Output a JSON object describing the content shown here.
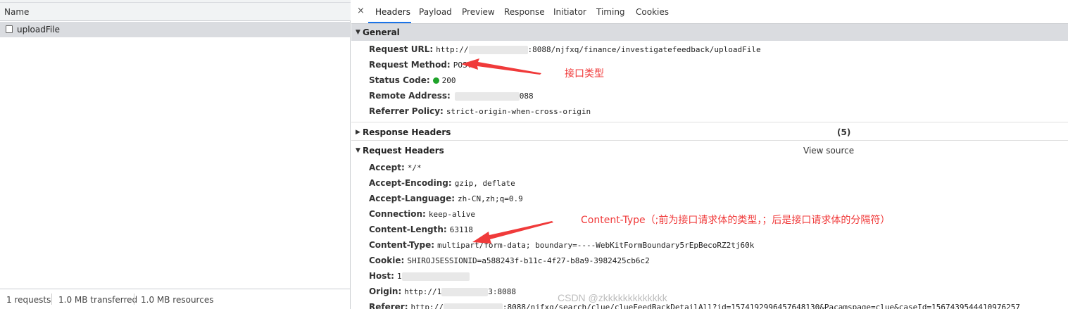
{
  "requests": {
    "column_header": "Name",
    "items": [
      {
        "name": "uploadFile"
      }
    ],
    "footer": {
      "requests": "1 requests",
      "transferred": "1.0 MB transferred",
      "resources": "1.0 MB resources"
    }
  },
  "tabs": {
    "close_glyph": "×",
    "items": [
      "Headers",
      "Payload",
      "Preview",
      "Response",
      "Initiator",
      "Timing",
      "Cookies"
    ],
    "active": "Headers"
  },
  "general": {
    "title": "General",
    "request_url": {
      "label": "Request URL:",
      "prefix": "http://",
      "suffix": ":8088/njfxq/finance/investigatefeedback/uploadFile"
    },
    "request_method": {
      "label": "Request Method:",
      "value": "POST"
    },
    "status_code": {
      "label": "Status Code:",
      "value": "200"
    },
    "remote_address": {
      "label": "Remote Address:",
      "suffix": "088"
    },
    "referrer_policy": {
      "label": "Referrer Policy:",
      "value": "strict-origin-when-cross-origin"
    }
  },
  "response_headers": {
    "title": "Response Headers",
    "count": "(5)"
  },
  "request_headers": {
    "title": "Request Headers",
    "view_source": "View source",
    "accept": {
      "label": "Accept:",
      "value": "*/*"
    },
    "accept_encoding": {
      "label": "Accept-Encoding:",
      "value": "gzip, deflate"
    },
    "accept_language": {
      "label": "Accept-Language:",
      "value": "zh-CN,zh;q=0.9"
    },
    "connection": {
      "label": "Connection:",
      "value": "keep-alive"
    },
    "content_length": {
      "label": "Content-Length:",
      "value": "63118"
    },
    "content_type": {
      "label": "Content-Type:",
      "value": "multipart/form-data; boundary=----WebKitFormBoundary5rEpBecoRZ2tj60k"
    },
    "cookie": {
      "label": "Cookie:",
      "value": "SHIROJSESSIONID=a588243f-b11c-4f27-b8a9-3982425cb6c2"
    },
    "host": {
      "label": "Host:",
      "value": "1"
    },
    "origin": {
      "label": "Origin:",
      "prefix": "http://1",
      "suffix": "3:8088"
    },
    "referer": {
      "label": "Referer:",
      "prefix": "http://",
      "suffix": ":8088/njfxq/search/clue/clueFeedBackDetailAll?id=1574192996457648130&Pacamspage=clue&caseId=1567439544410976257"
    }
  },
  "annotations": {
    "method_note": "接口类型",
    "content_type_note": "Content-Type（;前为接口请求体的类型，；后是接口请求体的分隔符）",
    "color": "#f03a3a"
  },
  "watermark": "CSDN @zkkkkkkkkkkkkk",
  "colors": {
    "accent": "#1a73e8",
    "status_ok": "#1fa32a",
    "section_bg": "#dadce0"
  }
}
